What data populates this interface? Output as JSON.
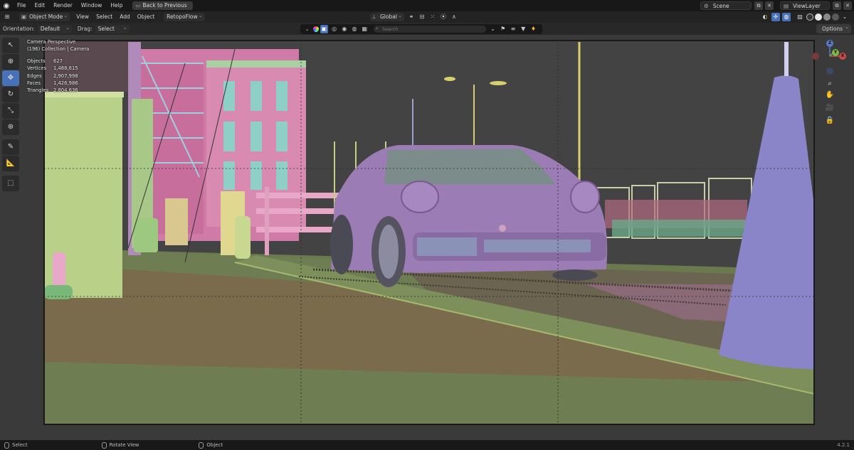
{
  "menubar": {
    "logo_icon": "blender-logo-icon",
    "items": [
      "File",
      "Edit",
      "Render",
      "Window",
      "Help"
    ],
    "back_button": "Back to Previous",
    "scene_label": "Scene",
    "viewlayer_label": "ViewLayer"
  },
  "header": {
    "mode": "Object Mode",
    "items": [
      "View",
      "Select",
      "Add",
      "Object"
    ],
    "addon_menu": "RetopoFlow",
    "transform_orientation": "Global"
  },
  "toolrow": {
    "orientation_label": "Orientation:",
    "orientation_value": "Default",
    "drag_label": "Drag:",
    "drag_value": "Select Box",
    "search_placeholder": "Search",
    "options_label": "Options"
  },
  "viewport": {
    "view_name": "Camera Perspective",
    "collection_line": "(196) Collection | Camera",
    "stats": [
      {
        "label": "Objects",
        "value": "627"
      },
      {
        "label": "Vertices",
        "value": "1,488,615"
      },
      {
        "label": "Edges",
        "value": "2,907,998"
      },
      {
        "label": "Faces",
        "value": "1,426,986"
      },
      {
        "label": "Triangles",
        "value": "2,804,636"
      }
    ],
    "gizmo": {
      "z": "Z",
      "y": "Y",
      "x": "X"
    }
  },
  "tools": [
    "cursor-select-icon",
    "cursor-icon",
    "move-icon",
    "rotate-icon",
    "scale-icon",
    "transform-icon",
    "annotate-icon",
    "measure-icon",
    "add-cube-icon"
  ],
  "statusbar": {
    "items": [
      "Select",
      "Rotate View",
      "Object"
    ],
    "version": "4.2.1"
  },
  "colors": {
    "accent": "#4872b8",
    "viewport_bg": "#404040",
    "car": "#9878b0",
    "ground": "#6b7a4e",
    "cone": "#8a84c8"
  }
}
